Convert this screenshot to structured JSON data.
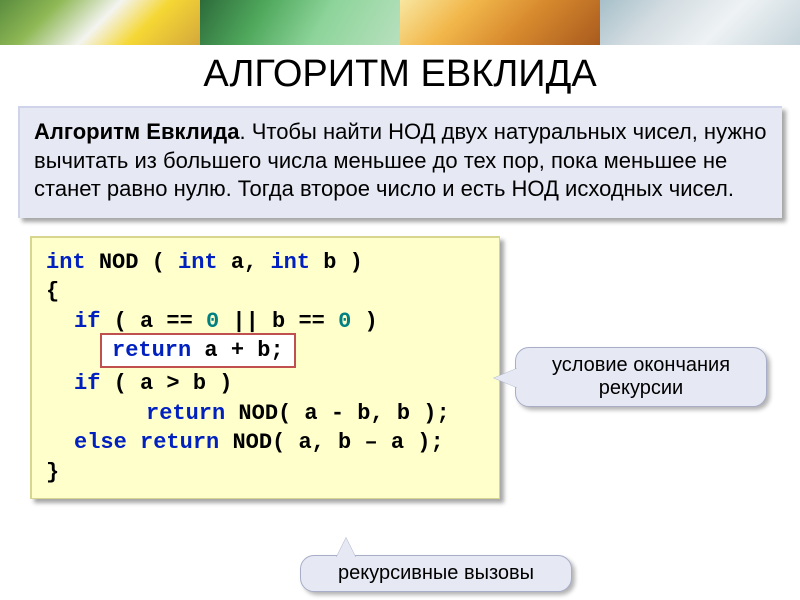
{
  "title": "АЛГОРИТМ ЕВКЛИДА",
  "desc": {
    "bold": "Алгоритм Евклида",
    "rest": ". Чтобы найти НОД двух натуральных чисел, нужно вычитать из большего числа меньшее до тех пор, пока меньшее не станет равно нулю. Тогда второе число и есть НОД исходных чисел."
  },
  "code": {
    "l1": {
      "kw_int1": "int",
      "sp1": " ",
      "fn": "NOD",
      "sp2": " ( ",
      "kw_int2": "int",
      "sp3": " a, ",
      "kw_int3": "int",
      "sp4": " b )"
    },
    "l2": "{",
    "l3": {
      "kw_if": "if",
      "cond": " ( a == 0 || b == 0 )",
      "zero1": "0",
      "zero2": "0",
      "pre": " ( a == ",
      "mid": " || b == ",
      "end": " )"
    },
    "l4": {
      "kw_return": "return",
      "expr": " a + b;"
    },
    "l5": {
      "kw_if": "if",
      "cond": " ( a > b )"
    },
    "l6": {
      "kw_return": "return",
      "sp": " ",
      "fn": "NOD",
      "args": "( a - b, b );"
    },
    "l7": {
      "kw_else": "else",
      "sp1": " ",
      "kw_return": "return",
      "sp2": " ",
      "fn": "NOD",
      "args": "( a, b – a );"
    },
    "l8": "}"
  },
  "callout1": {
    "line1": "условие окончания",
    "line2": "рекурсии"
  },
  "callout2": "рекурсивные вызовы"
}
